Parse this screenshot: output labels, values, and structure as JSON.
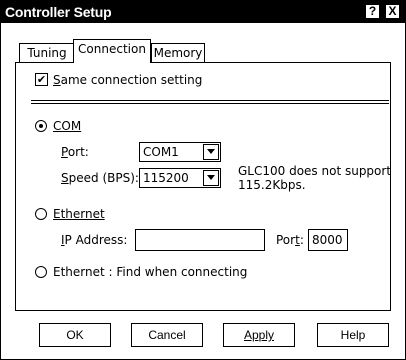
{
  "window": {
    "title": "Controller Setup",
    "help_button": "?",
    "close_button": "X"
  },
  "tabs": [
    {
      "label": "Tuning",
      "active": false
    },
    {
      "label": "Connection",
      "active": true
    },
    {
      "label": "Memory",
      "active": false
    }
  ],
  "connection": {
    "same_setting": {
      "checked": true,
      "mnemonic": "S",
      "rest": "ame connection setting"
    },
    "com": {
      "label": "COM",
      "selected": true,
      "port": {
        "label_mn": "P",
        "label_rest": "ort:",
        "value": "COM1"
      },
      "speed": {
        "label_mn": "S",
        "label_rest": "peed (BPS):",
        "value": "115200"
      },
      "note_line1": "GLC100 does not support",
      "note_line2": "115.2Kbps."
    },
    "ethernet": {
      "label": "Ethernet",
      "selected": false,
      "ip": {
        "label_mn": "I",
        "label_rest": "P Address:",
        "value": ""
      },
      "port": {
        "label_pre": "Por",
        "label_mn": "t",
        "label_post": ":",
        "value": "8000"
      }
    },
    "ethernet_find": {
      "label": "Ethernet : Find when connecting",
      "selected": false
    }
  },
  "buttons": {
    "ok": "OK",
    "cancel": "Cancel",
    "apply": "Apply",
    "help": "Help"
  }
}
